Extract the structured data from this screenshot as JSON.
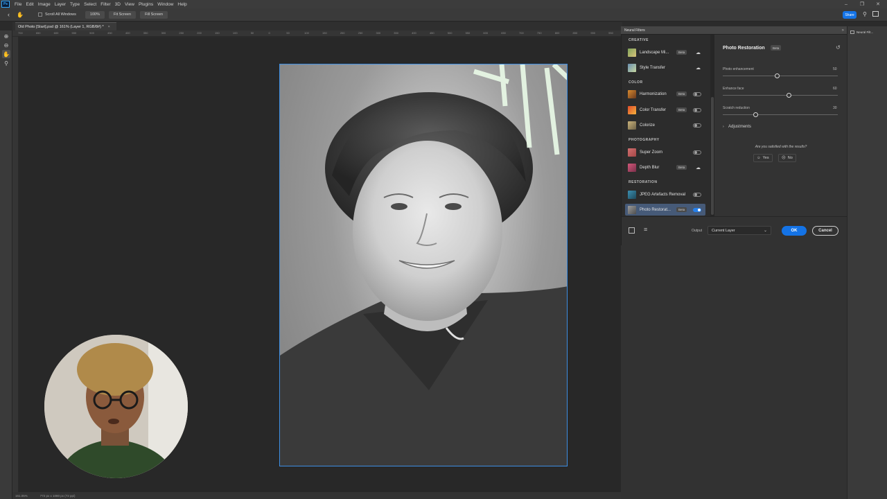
{
  "menubar": {
    "logo": "Ps",
    "items": [
      "File",
      "Edit",
      "Image",
      "Layer",
      "Type",
      "Select",
      "Filter",
      "3D",
      "View",
      "Plugins",
      "Window",
      "Help"
    ]
  },
  "options": {
    "scroll_all": "Scroll All Windows",
    "zoom": "100%",
    "fit_screen": "Fit Screen",
    "fill_screen": "Fill Screen",
    "share": "Share"
  },
  "document": {
    "tab_title": "Old Photo [Start].psd @ 161% (Layer 1, RGB/8#) *",
    "zoom_status": "161.05%",
    "size_status": "772 px x 1080 px (72 ppi)"
  },
  "ruler": {
    "top_ticks": [
      "700",
      "650",
      "600",
      "550",
      "500",
      "450",
      "400",
      "350",
      "300",
      "250",
      "200",
      "150",
      "100",
      "50",
      "0",
      "50",
      "100",
      "150",
      "200",
      "250",
      "300",
      "350",
      "400",
      "450",
      "500",
      "550",
      "600",
      "650",
      "700",
      "750",
      "800",
      "850",
      "900",
      "950"
    ]
  },
  "neural_filters": {
    "header": "Neural Filters",
    "sections": {
      "creative": "CREATIVE",
      "color": "COLOR",
      "photography": "PHOTOGRAPHY",
      "restoration": "RESTORATION"
    },
    "filters": [
      {
        "name": "Landscape Mi...",
        "badge": "Beta",
        "control": "cloud"
      },
      {
        "name": "Style Transfer",
        "badge": "",
        "control": "cloud"
      },
      {
        "name": "Harmonization",
        "badge": "Beta",
        "control": "toggle-off"
      },
      {
        "name": "Color Transfer",
        "badge": "Beta",
        "control": "toggle-off"
      },
      {
        "name": "Colorize",
        "badge": "",
        "control": "toggle-off"
      },
      {
        "name": "Super Zoom",
        "badge": "",
        "control": "toggle-off"
      },
      {
        "name": "Depth Blur",
        "badge": "Beta",
        "control": "cloud"
      },
      {
        "name": "JPEG Artefacts Removal",
        "badge": "",
        "control": "toggle-off"
      },
      {
        "name": "Photo Restorat...",
        "badge": "Beta",
        "control": "toggle-on"
      }
    ],
    "detail": {
      "title": "Photo Restoration",
      "badge": "Beta",
      "sliders": [
        {
          "label": "Photo enhancement",
          "value": "50",
          "level": 50
        },
        {
          "label": "Enhance face",
          "value": "60",
          "level": 60
        },
        {
          "label": "Scratch reduction",
          "value": "30",
          "level": 30
        }
      ],
      "adjustments": "Adjustments",
      "question": "Are you satisfied with the results?",
      "yes": "Yes",
      "no": "No"
    },
    "footer": {
      "output_label": "Output",
      "output_value": "Current Layer",
      "ok": "OK",
      "cancel": "Cancel"
    }
  },
  "dock": {
    "item": "Neural Filt..."
  },
  "colors": {
    "accent": "#1473e6",
    "selection": "#3d8ee3",
    "selected_row": "#465a78"
  }
}
